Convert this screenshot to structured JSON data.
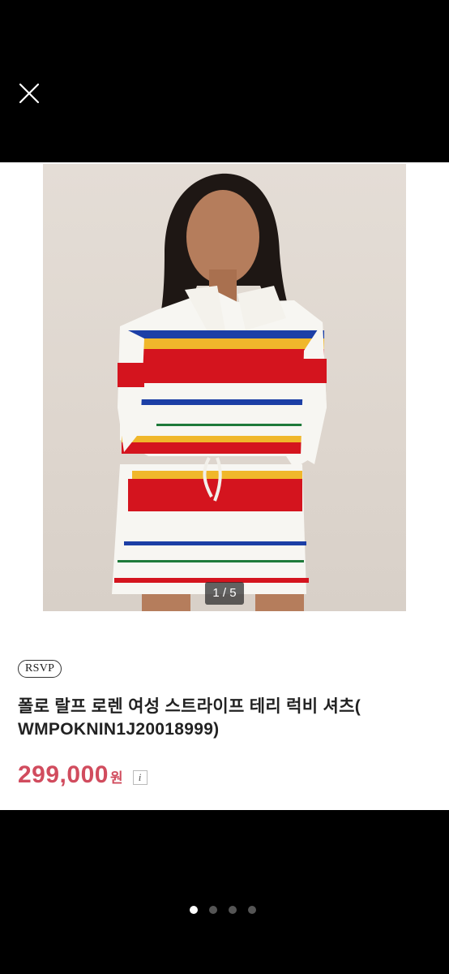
{
  "viewer": {
    "close_label": "Close",
    "page_indicator": "1 / 5",
    "carousel": {
      "total": 4,
      "active_index": 0
    }
  },
  "product": {
    "brand": "RSVP",
    "title_line1": "폴로 랄프 로렌 여성 스트라이프 테리 럭비 셔츠(",
    "title_line2": "WMPOKNIN1J20018999)",
    "price": "299,000",
    "currency": "원",
    "info_icon": "i"
  },
  "colors": {
    "price": "#d14c5e",
    "stripe_red": "#d4141e",
    "stripe_blue": "#1c3fa6",
    "stripe_yellow": "#f0b72b",
    "stripe_green": "#1e7a3a"
  }
}
